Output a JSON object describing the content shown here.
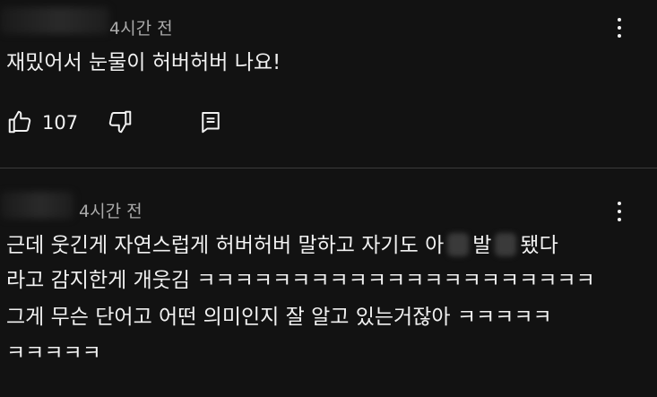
{
  "comments": [
    {
      "time": "4시간 전",
      "lines": [
        "재밌어서 눈물이 허버허버 나요!"
      ],
      "like_count": "107"
    },
    {
      "time": "4시간 전",
      "line1_a": "근데 웃긴게 자연스럽게 허버허버 말하고 자기도 아",
      "line1_b": "발",
      "line1_c": "됐다",
      "lines": [
        "라고 감지한게 개웃김 ㅋㅋㅋㅋㅋㅋㅋㅋㅋㅋㅋㅋㅋㅋㅋㅋㅋㅋㅋㅋㅋ",
        "그게 무슨 단어고 어떤 의미인지 잘 알고 있는거잖아 ㅋㅋㅋㅋㅋ",
        "ㅋㅋㅋㅋㅋ"
      ]
    }
  ],
  "icons": {
    "like": "thumbs-up-icon",
    "dislike": "thumbs-down-icon",
    "reply": "reply-icon",
    "menu": "more-vert-icon"
  }
}
